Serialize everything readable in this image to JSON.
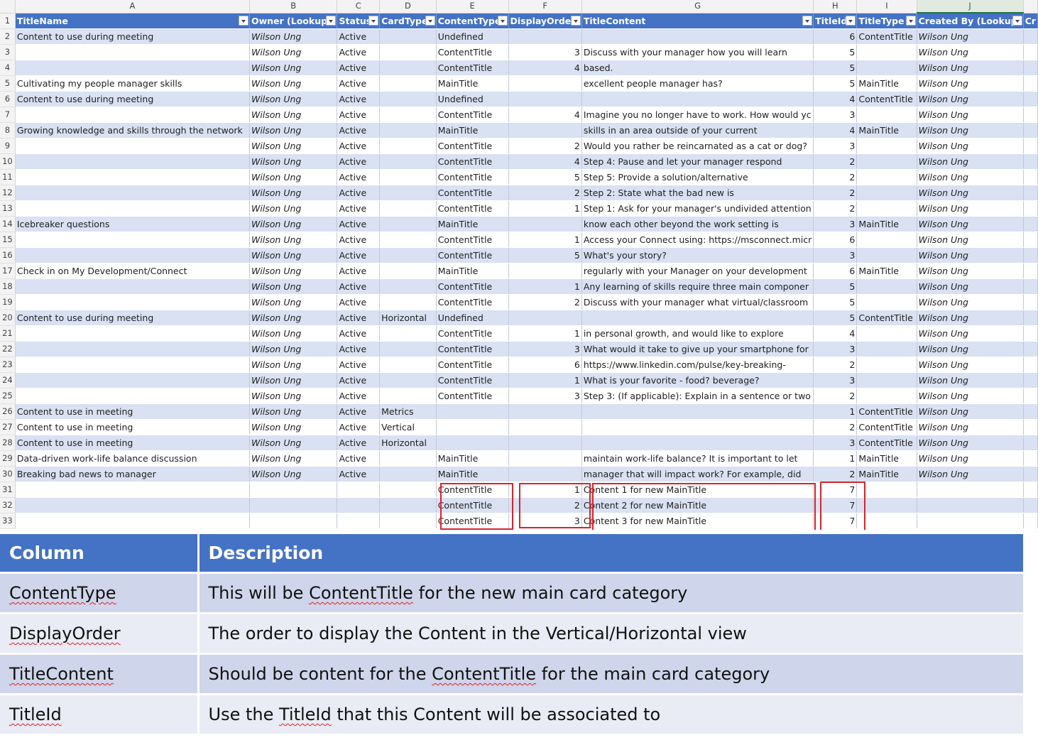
{
  "spreadsheet": {
    "column_letters": [
      "A",
      "B",
      "C",
      "D",
      "E",
      "F",
      "G",
      "H",
      "I",
      "J"
    ],
    "headers": [
      "TitleName",
      "Owner (Lookup)",
      "Status",
      "CardType",
      "ContentType",
      "DisplayOrder",
      "TitleContent",
      "TitleId",
      "TitleType",
      "Created By (Lookup)",
      "Cr"
    ],
    "rows": [
      {
        "n": "2",
        "a": "Content to use during meeting",
        "b": "Wilson Ung",
        "c": "Active",
        "d": "",
        "e": "Undefined",
        "f": "",
        "g": "",
        "h": "6",
        "i": "ContentTitle",
        "j": "Wilson Ung"
      },
      {
        "n": "3",
        "a": "",
        "b": "Wilson Ung",
        "c": "Active",
        "d": "",
        "e": "ContentTitle",
        "f": "3",
        "g": "Discuss with your manager how you will learn",
        "h": "5",
        "i": "",
        "j": "Wilson Ung"
      },
      {
        "n": "4",
        "a": "",
        "b": "Wilson Ung",
        "c": "Active",
        "d": "",
        "e": "ContentTitle",
        "f": "4",
        "g": "based.",
        "h": "5",
        "i": "",
        "j": "Wilson Ung"
      },
      {
        "n": "5",
        "a": "Cultivating my people manager skills",
        "b": "Wilson Ung",
        "c": "Active",
        "d": "",
        "e": "MainTitle",
        "f": "",
        "g": "excellent people manager has?",
        "h": "5",
        "i": "MainTitle",
        "j": "Wilson Ung"
      },
      {
        "n": "6",
        "a": "Content to use during meeting",
        "b": "Wilson Ung",
        "c": "Active",
        "d": "",
        "e": "Undefined",
        "f": "",
        "g": "",
        "h": "4",
        "i": "ContentTitle",
        "j": "Wilson Ung"
      },
      {
        "n": "7",
        "a": "",
        "b": "Wilson Ung",
        "c": "Active",
        "d": "",
        "e": "ContentTitle",
        "f": "4",
        "g": "Imagine you no longer have to work. How would yc",
        "h": "3",
        "i": "",
        "j": "Wilson Ung"
      },
      {
        "n": "8",
        "a": "Growing knowledge and skills through the network",
        "b": "Wilson Ung",
        "c": "Active",
        "d": "",
        "e": "MainTitle",
        "f": "",
        "g": "skills in an area outside of your current",
        "h": "4",
        "i": "MainTitle",
        "j": "Wilson Ung"
      },
      {
        "n": "9",
        "a": "",
        "b": "Wilson Ung",
        "c": "Active",
        "d": "",
        "e": "ContentTitle",
        "f": "2",
        "g": "Would you rather be reincarnated as a cat or dog?",
        "h": "3",
        "i": "",
        "j": "Wilson Ung"
      },
      {
        "n": "10",
        "a": "",
        "b": "Wilson Ung",
        "c": "Active",
        "d": "",
        "e": "ContentTitle",
        "f": "4",
        "g": "Step 4: Pause and let your manager respond",
        "h": "2",
        "i": "",
        "j": "Wilson Ung"
      },
      {
        "n": "11",
        "a": "",
        "b": "Wilson Ung",
        "c": "Active",
        "d": "",
        "e": "ContentTitle",
        "f": "5",
        "g": "Step 5: Provide a solution/alternative",
        "h": "2",
        "i": "",
        "j": "Wilson Ung"
      },
      {
        "n": "12",
        "a": "",
        "b": "Wilson Ung",
        "c": "Active",
        "d": "",
        "e": "ContentTitle",
        "f": "2",
        "g": "Step 2: State what the bad new is",
        "h": "2",
        "i": "",
        "j": "Wilson Ung"
      },
      {
        "n": "13",
        "a": "",
        "b": "Wilson Ung",
        "c": "Active",
        "d": "",
        "e": "ContentTitle",
        "f": "1",
        "g": "Step 1: Ask for your manager's undivided attention",
        "h": "2",
        "i": "",
        "j": "Wilson Ung"
      },
      {
        "n": "14",
        "a": "Icebreaker questions",
        "b": "Wilson Ung",
        "c": "Active",
        "d": "",
        "e": "MainTitle",
        "f": "",
        "g": "know each other beyond the work setting is",
        "h": "3",
        "i": "MainTitle",
        "j": "Wilson Ung"
      },
      {
        "n": "15",
        "a": "",
        "b": "Wilson Ung",
        "c": "Active",
        "d": "",
        "e": "ContentTitle",
        "f": "1",
        "g": "Access your Connect using: https://msconnect.micr",
        "h": "6",
        "i": "",
        "j": "Wilson Ung"
      },
      {
        "n": "16",
        "a": "",
        "b": "Wilson Ung",
        "c": "Active",
        "d": "",
        "e": "ContentTitle",
        "f": "5",
        "g": "What's your story?",
        "h": "3",
        "i": "",
        "j": "Wilson Ung"
      },
      {
        "n": "17",
        "a": "Check in on My Development/Connect",
        "b": "Wilson Ung",
        "c": "Active",
        "d": "",
        "e": "MainTitle",
        "f": "",
        "g": "regularly with your Manager on your development",
        "h": "6",
        "i": "MainTitle",
        "j": "Wilson Ung"
      },
      {
        "n": "18",
        "a": "",
        "b": "Wilson Ung",
        "c": "Active",
        "d": "",
        "e": "ContentTitle",
        "f": "1",
        "g": "Any learning of skills require three main componer",
        "h": "5",
        "i": "",
        "j": "Wilson Ung"
      },
      {
        "n": "19",
        "a": "",
        "b": "Wilson Ung",
        "c": "Active",
        "d": "",
        "e": "ContentTitle",
        "f": "2",
        "g": "Discuss with your manager what virtual/classroom",
        "h": "5",
        "i": "",
        "j": "Wilson Ung"
      },
      {
        "n": "20",
        "a": "Content to use during meeting",
        "b": "Wilson Ung",
        "c": "Active",
        "d": "Horizontal",
        "e": "Undefined",
        "f": "",
        "g": "",
        "h": "5",
        "i": "ContentTitle",
        "j": "Wilson Ung"
      },
      {
        "n": "21",
        "a": "",
        "b": "Wilson Ung",
        "c": "Active",
        "d": "",
        "e": "ContentTitle",
        "f": "1",
        "g": "in personal growth, and would like to explore",
        "h": "4",
        "i": "",
        "j": "Wilson Ung"
      },
      {
        "n": "22",
        "a": "",
        "b": "Wilson Ung",
        "c": "Active",
        "d": "",
        "e": "ContentTitle",
        "f": "3",
        "g": "What would it take to give up your smartphone for",
        "h": "3",
        "i": "",
        "j": "Wilson Ung"
      },
      {
        "n": "23",
        "a": "",
        "b": "Wilson Ung",
        "c": "Active",
        "d": "",
        "e": "ContentTitle",
        "f": "6",
        "g": "https://www.linkedin.com/pulse/key-breaking-",
        "h": "2",
        "i": "",
        "j": "Wilson Ung"
      },
      {
        "n": "24",
        "a": "",
        "b": "Wilson Ung",
        "c": "Active",
        "d": "",
        "e": "ContentTitle",
        "f": "1",
        "g": "What is your favorite - food? beverage?",
        "h": "3",
        "i": "",
        "j": "Wilson Ung"
      },
      {
        "n": "25",
        "a": "",
        "b": "Wilson Ung",
        "c": "Active",
        "d": "",
        "e": "ContentTitle",
        "f": "3",
        "g": "Step 3: (If applicable): Explain in a sentence or two",
        "h": "2",
        "i": "",
        "j": "Wilson Ung"
      },
      {
        "n": "26",
        "a": "Content to use in meeting",
        "b": "Wilson Ung",
        "c": "Active",
        "d": "Metrics",
        "e": "",
        "f": "",
        "g": "",
        "h": "1",
        "i": "ContentTitle",
        "j": "Wilson Ung"
      },
      {
        "n": "27",
        "a": "Content to use in meeting",
        "b": "Wilson Ung",
        "c": "Active",
        "d": "Vertical",
        "e": "",
        "f": "",
        "g": "",
        "h": "2",
        "i": "ContentTitle",
        "j": "Wilson Ung"
      },
      {
        "n": "28",
        "a": "Content to use in meeting",
        "b": "Wilson Ung",
        "c": "Active",
        "d": "Horizontal",
        "e": "",
        "f": "",
        "g": "",
        "h": "3",
        "i": "ContentTitle",
        "j": "Wilson Ung"
      },
      {
        "n": "29",
        "a": "Data-driven work-life balance discussion",
        "b": "Wilson Ung",
        "c": "Active",
        "d": "",
        "e": "MainTitle",
        "f": "",
        "g": "maintain work-life balance? It is important to let",
        "h": "1",
        "i": "MainTitle",
        "j": "Wilson Ung"
      },
      {
        "n": "30",
        "a": "Breaking bad news to manager",
        "b": "Wilson Ung",
        "c": "Active",
        "d": "",
        "e": "MainTitle",
        "f": "",
        "g": "manager that will impact work? For example, did",
        "h": "2",
        "i": "MainTitle",
        "j": "Wilson Ung"
      },
      {
        "n": "31",
        "a": "",
        "b": "",
        "c": "",
        "d": "",
        "e": "ContentTitle",
        "f": "1",
        "g": "Content 1 for new MainTitle",
        "h": "7",
        "i": "",
        "j": ""
      },
      {
        "n": "32",
        "a": "",
        "b": "",
        "c": "",
        "d": "",
        "e": "ContentTitle",
        "f": "2",
        "g": "Content 2 for new MainTitle",
        "h": "7",
        "i": "",
        "j": ""
      },
      {
        "n": "33",
        "a": "",
        "b": "",
        "c": "",
        "d": "",
        "e": "ContentTitle",
        "f": "3",
        "g": "Content 3 for new MainTitle",
        "h": "7",
        "i": "",
        "j": ""
      }
    ]
  },
  "legend": {
    "header": {
      "column": "Column",
      "description": "Description"
    },
    "rows": [
      {
        "column": "ContentType",
        "description_pre": "This will be ",
        "description_key": "ContentTitle",
        "description_post": " for the new main card category"
      },
      {
        "column": "DisplayOrder",
        "description_pre": "The order to display the Content in the Vertical/Horizontal view",
        "description_key": "",
        "description_post": ""
      },
      {
        "column": "TitleContent",
        "description_pre": "Should be content for the ",
        "description_key": "ContentTitle",
        "description_post": " for the main card category"
      },
      {
        "column": "TitleId",
        "description_pre": "Use the ",
        "description_key": "TitleId",
        "description_post": " that this Content will be associated to"
      }
    ]
  },
  "colors": {
    "header_blue": "#4472c4",
    "band_blue": "#d9e1f2",
    "highlight_red": "#d7242c"
  }
}
